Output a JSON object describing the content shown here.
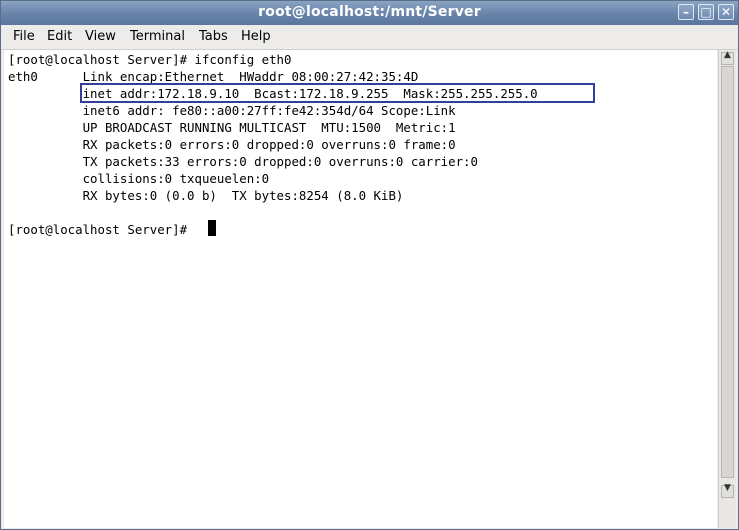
{
  "window": {
    "title": "root@localhost:/mnt/Server"
  },
  "controls": {
    "minimize": "–",
    "maximize": "□",
    "close": "✕"
  },
  "menu": {
    "items": [
      "File",
      "Edit",
      "View",
      "Terminal",
      "Tabs",
      "Help"
    ]
  },
  "terminal": {
    "lines": [
      "[root@localhost Server]# ifconfig eth0",
      "eth0      Link encap:Ethernet  HWaddr 08:00:27:42:35:4D",
      "          inet addr:172.18.9.10  Bcast:172.18.9.255  Mask:255.255.255.0",
      "          inet6 addr: fe80::a00:27ff:fe42:354d/64 Scope:Link",
      "          UP BROADCAST RUNNING MULTICAST  MTU:1500  Metric:1",
      "          RX packets:0 errors:0 dropped:0 overruns:0 frame:0",
      "          TX packets:33 errors:0 dropped:0 overruns:0 carrier:0",
      "          collisions:0 txqueuelen:0",
      "          RX bytes:0 (0.0 b)  TX bytes:8254 (8.0 KiB)",
      "",
      "[root@localhost Server]# "
    ]
  },
  "scrollbar": {
    "up_icon": "▲",
    "down_icon": "▼"
  },
  "colors": {
    "titlebar": "#6783a9",
    "highlight": "#343f9a",
    "terminal_bg": "#ffffff"
  }
}
